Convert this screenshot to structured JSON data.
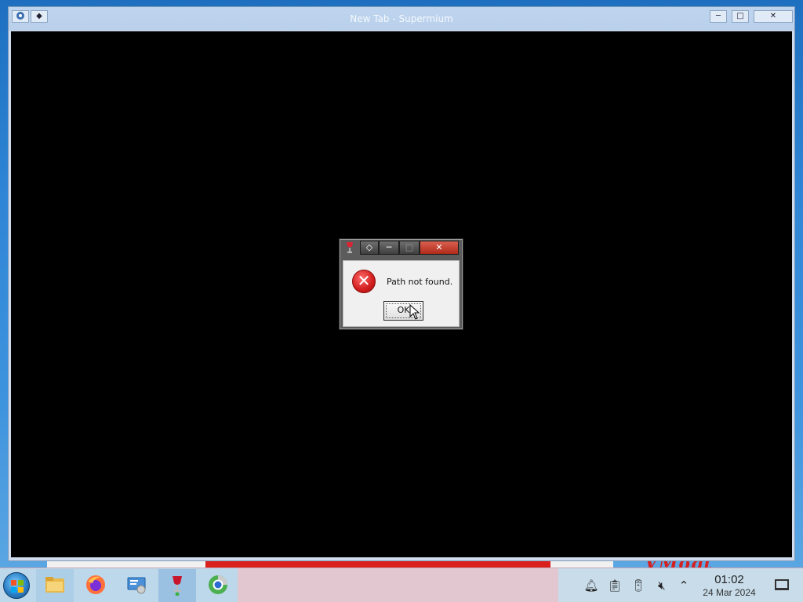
{
  "browser": {
    "title": "New Tab - Supermium",
    "titlebar_left_buttons": [
      "◆"
    ],
    "titlebar_right_buttons": [
      "─",
      "□",
      "✕"
    ]
  },
  "dialog": {
    "message": "Path not found.",
    "ok_label": "OK",
    "buttons": [
      "◇",
      "─",
      "□",
      "✕"
    ]
  },
  "wallpaper": {
    "logo_text": "VMoqt"
  },
  "taskbar": {
    "apps": [
      {
        "name": "file-explorer",
        "active": false
      },
      {
        "name": "firefox",
        "active": false
      },
      {
        "name": "control-panel",
        "active": false
      },
      {
        "name": "wine-app",
        "active": true
      },
      {
        "name": "supermium",
        "active": false
      }
    ],
    "tray": {
      "time": "01:02",
      "date": "24 Mar 2024"
    }
  },
  "colors": {
    "dialog_close": "#c2392a",
    "taskbar_bg": "#e2c7d1",
    "error_red": "#d11d1d"
  }
}
